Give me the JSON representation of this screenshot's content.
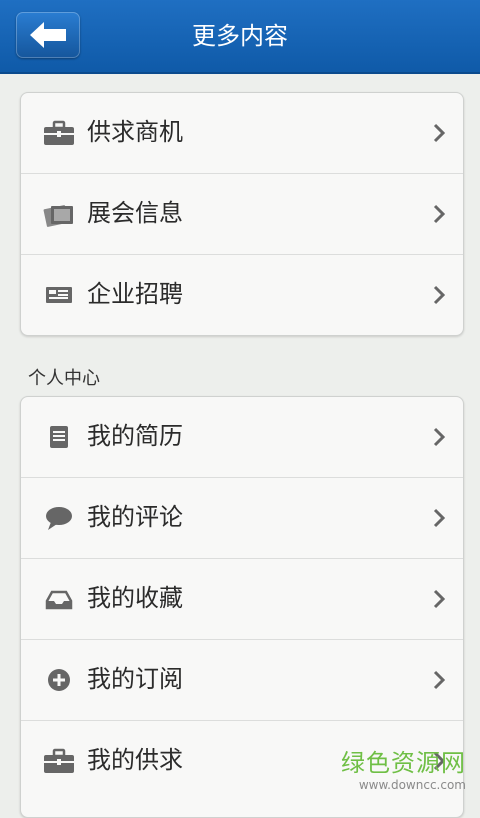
{
  "header": {
    "title": "更多内容"
  },
  "groups": [
    {
      "items": [
        {
          "label": "供求商机",
          "icon": "briefcase-icon"
        },
        {
          "label": "展会信息",
          "icon": "cards-icon"
        },
        {
          "label": "企业招聘",
          "icon": "id-card-icon"
        }
      ]
    },
    {
      "title": "个人中心",
      "items": [
        {
          "label": "我的简历",
          "icon": "document-icon"
        },
        {
          "label": "我的评论",
          "icon": "speech-bubble-icon"
        },
        {
          "label": "我的收藏",
          "icon": "inbox-icon"
        },
        {
          "label": "我的订阅",
          "icon": "plus-circle-icon"
        },
        {
          "label": "我的供求",
          "icon": "briefcase-icon"
        }
      ]
    }
  ],
  "watermark": {
    "main": "绿色资源网",
    "sub": "www.downcc.com"
  }
}
